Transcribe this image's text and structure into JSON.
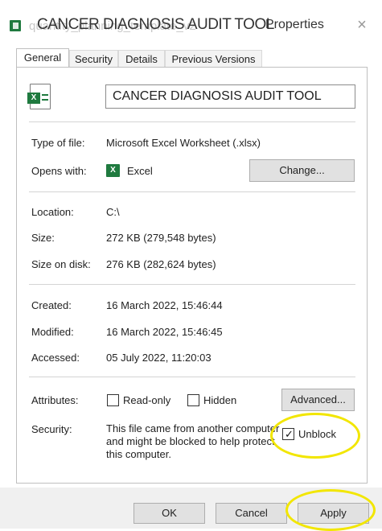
{
  "window": {
    "title_ghost": "quantity_planning_template_v2",
    "title": "CANCER DIAGNOSIS AUDIT TOOL",
    "title_suffix": "Properties",
    "close_label": "×"
  },
  "tabs": [
    {
      "label": "General",
      "active": true
    },
    {
      "label": "Security",
      "active": false
    },
    {
      "label": "Details",
      "active": false
    },
    {
      "label": "Previous Versions",
      "active": false
    }
  ],
  "file": {
    "icon": "excel-file-icon",
    "name": "CANCER DIAGNOSIS AUDIT TOOL"
  },
  "properties": {
    "type_label": "Type of file:",
    "type_value": "Microsoft Excel Worksheet (.xlsx)",
    "opens_label": "Opens with:",
    "opens_value": "Excel",
    "change_button": "Change...",
    "location_label": "Location:",
    "location_value": "C:\\",
    "size_label": "Size:",
    "size_value": "272 KB (279,548 bytes)",
    "size_on_disk_label": "Size on disk:",
    "size_on_disk_value": "276 KB (282,624 bytes)",
    "created_label": "Created:",
    "created_value": "16 March 2022, 15:46:44",
    "modified_label": "Modified:",
    "modified_value": "16 March 2022, 15:46:45",
    "accessed_label": "Accessed:",
    "accessed_value": "05 July 2022, 11:20:03",
    "attributes_label": "Attributes:",
    "readonly_label": "Read-only",
    "hidden_label": "Hidden",
    "advanced_button": "Advanced...",
    "security_label": "Security:",
    "security_text": "This file came from another computer and might be blocked to help protect this computer.",
    "unblock_label": "Unblock",
    "unblock_checked": true
  },
  "footer": {
    "ok": "OK",
    "cancel": "Cancel",
    "apply": "Apply"
  },
  "colors": {
    "excel_green": "#1f7a3f",
    "highlight": "#f2e600"
  }
}
